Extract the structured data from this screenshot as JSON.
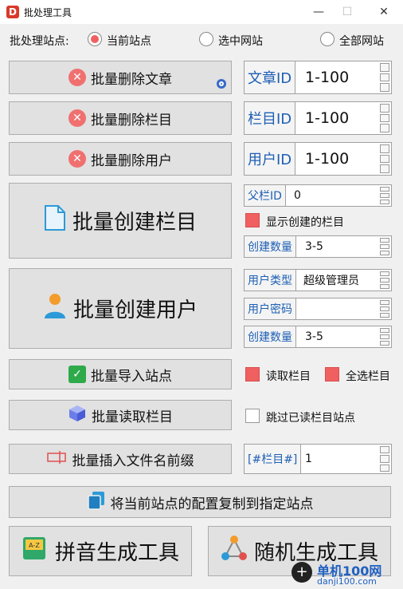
{
  "window": {
    "title": "批处理工具",
    "logo_text": "D",
    "minimize": "—",
    "maximize": "☐",
    "close": "✕"
  },
  "sites": {
    "label": "批处理站点:",
    "options": [
      {
        "label": "当前站点",
        "checked": true
      },
      {
        "label": "选中网站",
        "checked": false
      },
      {
        "label": "全部网站",
        "checked": false
      }
    ]
  },
  "buttons": {
    "delete_articles": "批量删除文章",
    "delete_columns": "批量删除栏目",
    "delete_users": "批量删除用户",
    "create_columns": "批量创建栏目",
    "create_users": "批量创建用户",
    "import_sites": "批量导入站点",
    "read_columns": "批量读取栏目",
    "insert_prefix": "批量插入文件名前缀",
    "copy_config": "将当前站点的配置复制到指定站点",
    "pinyin_tool": "拼音生成工具",
    "random_tool": "随机生成工具"
  },
  "fields": {
    "article_id": {
      "label": "文章ID",
      "value": "1-100"
    },
    "column_id": {
      "label": "栏目ID",
      "value": "1-100"
    },
    "user_id": {
      "label": "用户ID",
      "value": "1-100"
    },
    "parent_id": {
      "label": "父栏ID",
      "value": "0"
    },
    "create_count_columns": {
      "label": "创建数量",
      "value": "3-5"
    },
    "user_type": {
      "label": "用户类型",
      "value": "超级管理员"
    },
    "user_password": {
      "label": "用户密码",
      "value": ""
    },
    "create_count_users": {
      "label": "创建数量",
      "value": "3-5"
    },
    "column_tag": {
      "label": "[#栏目#]",
      "value": "1"
    }
  },
  "checkboxes": {
    "show_created": {
      "label": "显示创建的栏目",
      "checked": true
    },
    "read_columns": {
      "label": "读取栏目",
      "checked": true
    },
    "select_all_columns": {
      "label": "全选栏目",
      "checked": true
    },
    "skip_read_sites": {
      "label": "跳过已读栏目站点",
      "checked": false
    }
  },
  "watermark": {
    "title": "单机100网",
    "url": "danji100.com"
  },
  "colors": {
    "accent_red": "#f06060",
    "label_blue": "#1e5fb5",
    "button_bg": "#e1e1e1"
  }
}
